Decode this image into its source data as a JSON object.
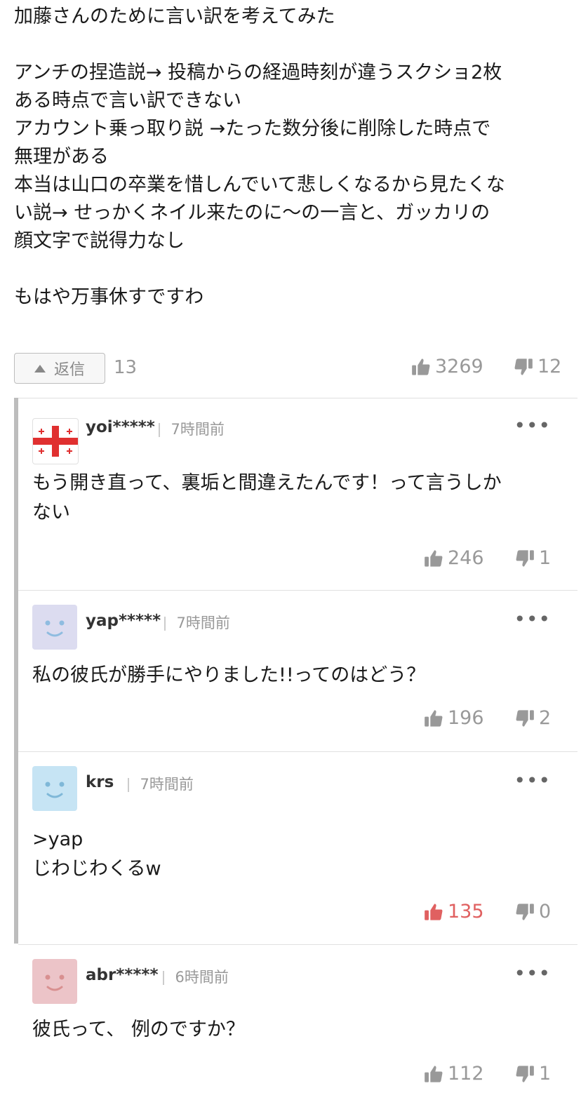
{
  "post": {
    "lines": [
      "加藤さんのために言い訳を考えてみた",
      "",
      "アンチの捏造説→ 投稿からの経過時刻が違うスクショ2枚",
      "ある時点で言い訳できない",
      "アカウント乗っ取り説 →たった数分後に削除した時点で",
      "無理がある",
      "本当は山口の卒業を惜しんでいて悲しくなるから見たくな",
      "い説→ せっかくネイル来たのに〜の一言と、ガッカリの",
      "顔文字で説得力なし",
      "",
      "もはや万事休すですわ"
    ],
    "reply_label": "返信",
    "reply_count": "13",
    "likes": "3269",
    "dislikes": "12"
  },
  "replies": [
    {
      "user": "yoi*****",
      "time": "7時間前",
      "lines": [
        "もう開き直って、裏垢と間違えたんです！って言うしか",
        "ない"
      ],
      "likes": "246",
      "dislikes": "1",
      "avatar": "flag",
      "liked": false
    },
    {
      "user": "yap*****",
      "time": "7時間前",
      "lines": [
        "私の彼氏が勝手にやりました!!ってのはどう？"
      ],
      "likes": "196",
      "dislikes": "2",
      "avatar": "face-lavender",
      "liked": false
    },
    {
      "user": "krs",
      "time": "7時間前",
      "lines": [
        ">yap",
        "じわじわくるw"
      ],
      "likes": "135",
      "dislikes": "0",
      "avatar": "face-blue",
      "liked": true
    },
    {
      "user": "abr*****",
      "time": "6時間前",
      "lines": [
        "彼氏って、 例のですか？"
      ],
      "likes": "112",
      "dislikes": "1",
      "avatar": "face-pink",
      "liked": false
    }
  ],
  "colors": {
    "vote_default": "#999999",
    "vote_liked": "#e06060",
    "thread_line": "#bdbdbd"
  },
  "icons": {
    "thumb_up": "thumbs-up-icon",
    "thumb_down": "thumbs-down-icon",
    "more": "more-icon",
    "reply_arrow": "triangle-up-icon"
  }
}
